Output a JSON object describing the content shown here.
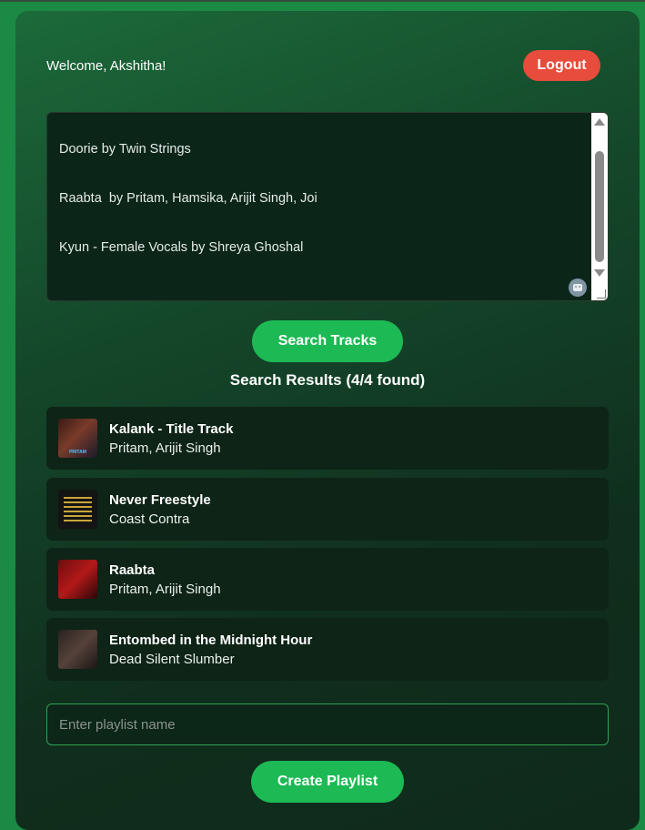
{
  "header": {
    "welcome_text": "Welcome, Akshitha!",
    "logout_label": "Logout"
  },
  "track_input": {
    "lines": [
      "Doorie by Twin Strings",
      "Raabta  by Pritam, Hamsika, Arijit Singh, Joi",
      "Kyun - Female Vocals by Shreya Ghoshal"
    ]
  },
  "search_button_label": "Search Tracks",
  "results": {
    "heading": "Search Results (4/4 found)",
    "items": [
      {
        "title": "Kalank - Title Track",
        "artist": "Pritam, Arijit Singh",
        "thumb_text": "PRITAM"
      },
      {
        "title": "Never Freestyle",
        "artist": "Coast Contra"
      },
      {
        "title": "Raabta",
        "artist": "Pritam, Arijit Singh"
      },
      {
        "title": "Entombed in the Midnight Hour",
        "artist": "Dead Silent Slumber"
      }
    ]
  },
  "playlist": {
    "placeholder": "Enter playlist name",
    "create_label": "Create Playlist"
  },
  "colors": {
    "accent_green": "#1db954",
    "logout_red": "#e74c3c",
    "page_bg": "#1b8a44"
  },
  "icons": {
    "assistant": "bot-icon"
  }
}
